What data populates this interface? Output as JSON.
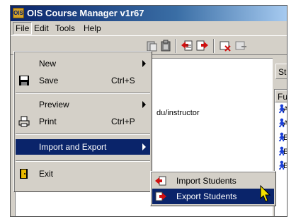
{
  "window": {
    "app_icon_text": "OIS",
    "title": "OIS Course Manager v1r67"
  },
  "menubar": {
    "items": [
      {
        "label": "File",
        "active": true
      },
      {
        "label": "Edit"
      },
      {
        "label": "Tools"
      },
      {
        "label": "Help"
      }
    ]
  },
  "file_menu": {
    "items": [
      {
        "label": "New",
        "submenu": true
      },
      {
        "label": "Save",
        "shortcut": "Ctrl+S",
        "icon": "save-disk-icon"
      },
      {
        "label": "Preview",
        "submenu": true
      },
      {
        "label": "Print",
        "shortcut": "Ctrl+P",
        "icon": "printer-icon"
      },
      {
        "label": "Import and Export",
        "submenu": true,
        "highlighted": true
      },
      {
        "label": "Exit",
        "icon": "exit-door-icon"
      }
    ]
  },
  "submenu": {
    "items": [
      {
        "label": "Import Students",
        "icon": "import-students-icon"
      },
      {
        "label": "Export Students",
        "icon": "export-students-icon",
        "highlighted": true
      }
    ]
  },
  "main": {
    "path_text": "du/instructor"
  },
  "right_pane": {
    "tab_label": "Stud",
    "column_header": "Full",
    "rows": [
      "A",
      "A",
      "E",
      "E",
      "E"
    ]
  },
  "colors": {
    "highlight": "#0a246a",
    "face": "#d4d0c8",
    "person_icon": "#1a3fd6"
  }
}
